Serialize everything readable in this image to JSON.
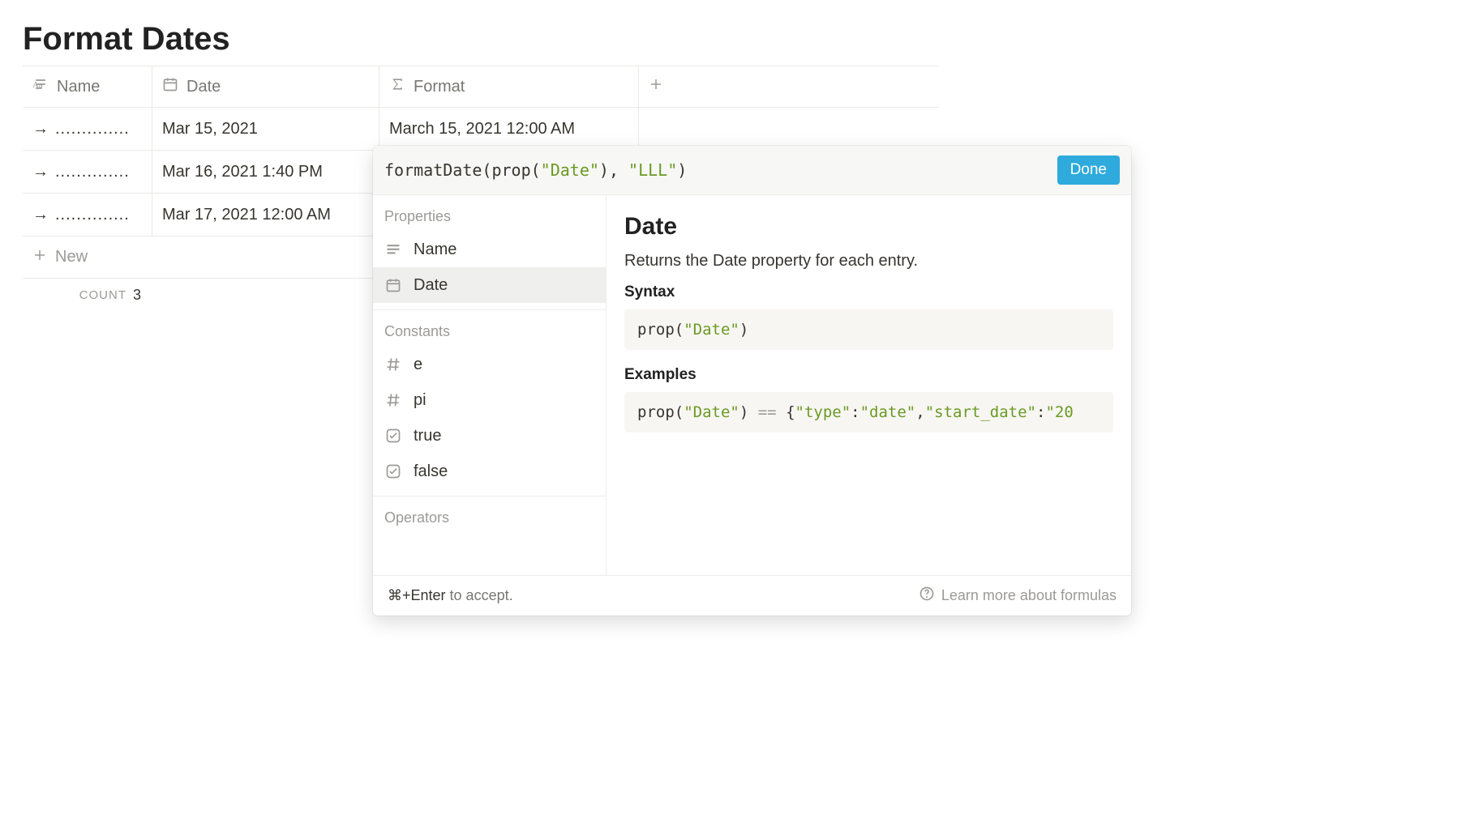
{
  "page": {
    "title": "Format Dates"
  },
  "columns": {
    "name": "Name",
    "date": "Date",
    "format": "Format"
  },
  "rows": [
    {
      "name": "..............",
      "date": "Mar 15, 2021",
      "format": "March 15, 2021 12:00 AM"
    },
    {
      "name": "..............",
      "date": "Mar 16, 2021 1:40 PM",
      "format": ""
    },
    {
      "name": "..............",
      "date": "Mar 17, 2021 12:00 AM",
      "format": ""
    }
  ],
  "new_row_label": "New",
  "count": {
    "label": "COUNT",
    "value": "3"
  },
  "formula": {
    "prefix": "formatDate(prop(",
    "arg1": "\"Date\"",
    "mid": "), ",
    "arg2": "\"LLL\"",
    "suffix": ")",
    "done": "Done"
  },
  "panel": {
    "properties_label": "Properties",
    "constants_label": "Constants",
    "operators_label": "Operators",
    "properties": [
      {
        "label": "Name"
      },
      {
        "label": "Date"
      }
    ],
    "constants": [
      {
        "label": "e"
      },
      {
        "label": "pi"
      },
      {
        "label": "true"
      },
      {
        "label": "false"
      }
    ]
  },
  "detail": {
    "title": "Date",
    "desc": "Returns the Date property for each entry.",
    "syntax_label": "Syntax",
    "syntax_code_pre": "prop(",
    "syntax_code_str": "\"Date\"",
    "syntax_code_post": ")",
    "examples_label": "Examples",
    "example_pre": "prop(",
    "example_str1": "\"Date\"",
    "example_mid1": ") ",
    "example_op": "==",
    "example_mid2": " {",
    "example_str2": "\"type\"",
    "example_colon1": ":",
    "example_str3": "\"date\"",
    "example_comma": ",",
    "example_str4": "\"start_date\"",
    "example_colon2": ":",
    "example_str5": "\"20"
  },
  "footer": {
    "kbd": "⌘+Enter",
    "rest": " to accept.",
    "learn": "Learn more about formulas"
  }
}
